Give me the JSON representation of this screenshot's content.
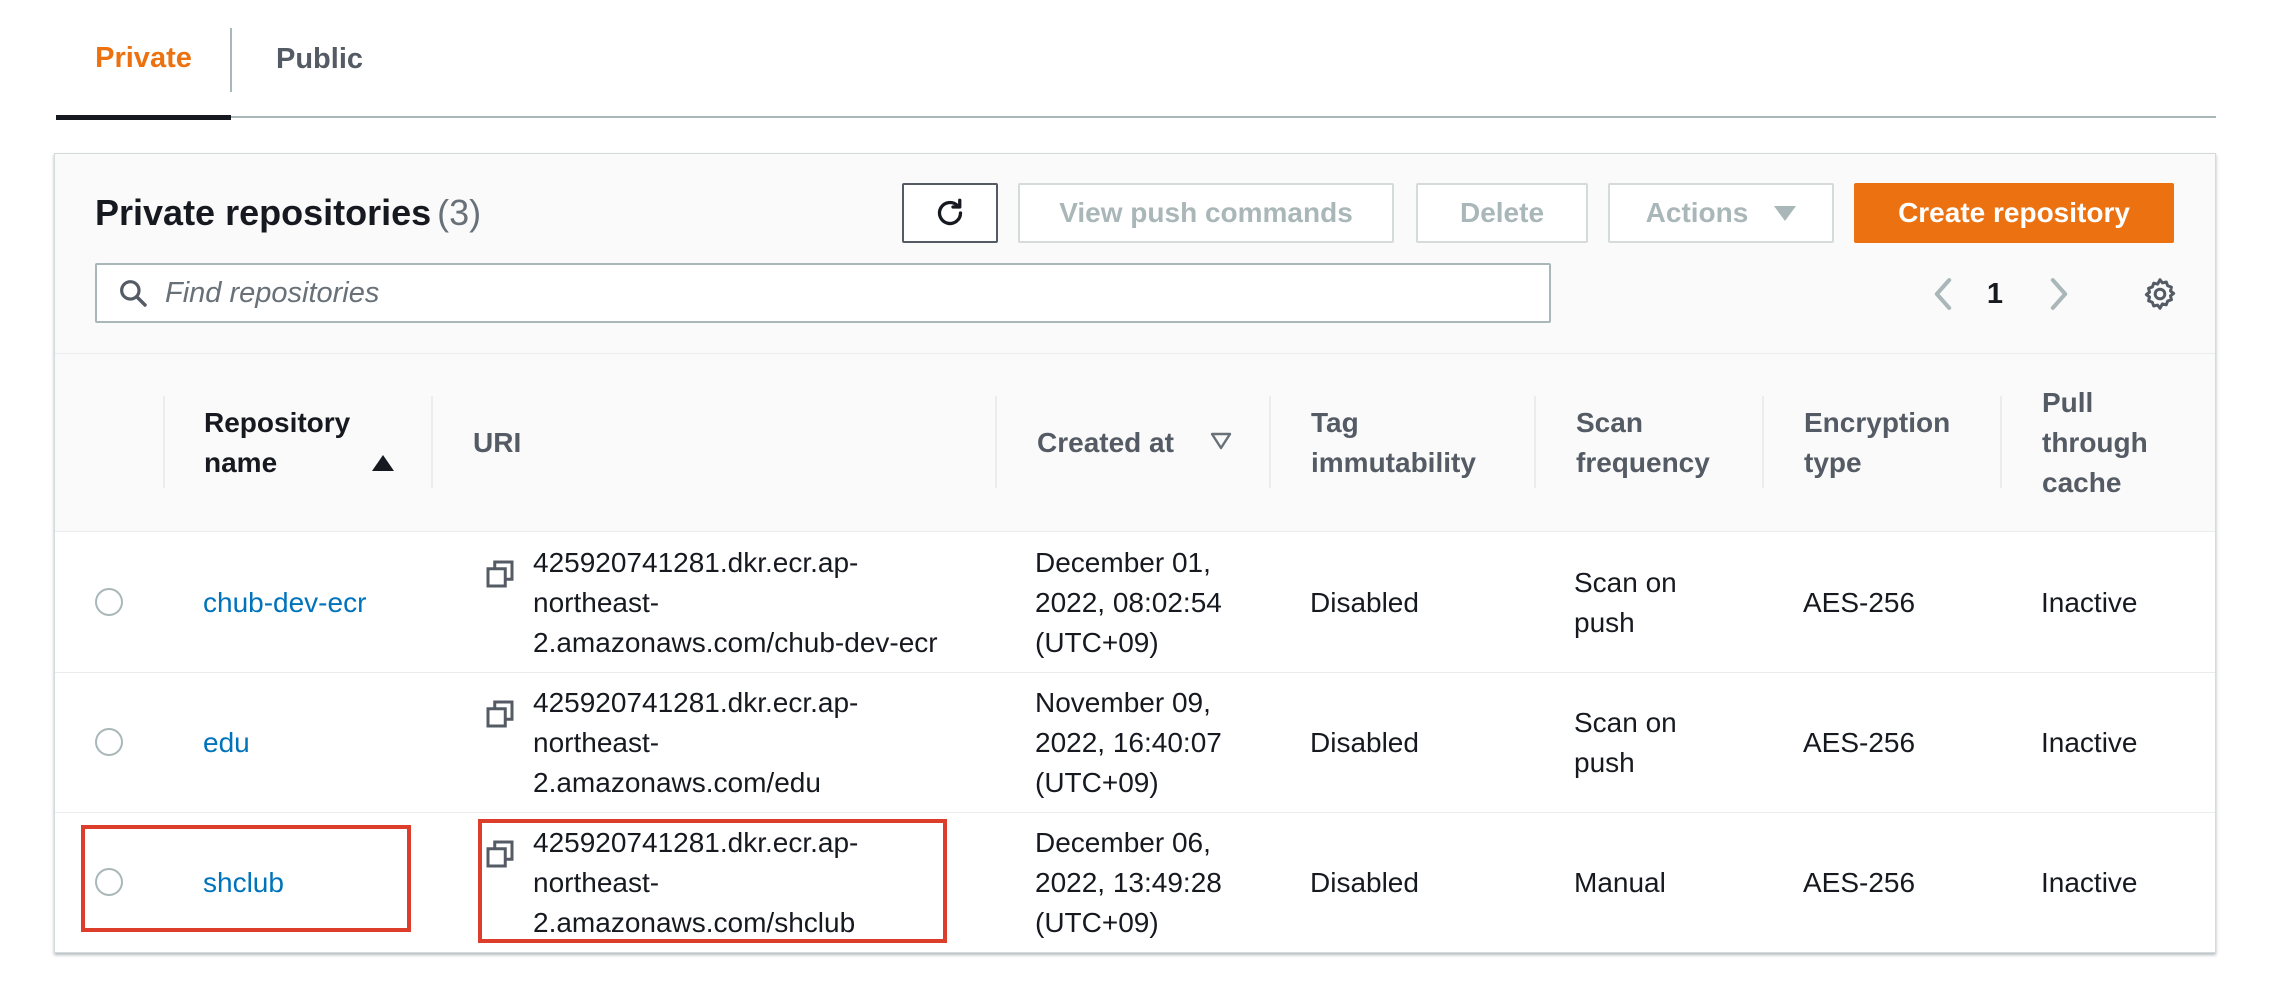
{
  "tabs": [
    {
      "label": "Private",
      "active": true
    },
    {
      "label": "Public",
      "active": false
    }
  ],
  "header": {
    "title": "Private repositories",
    "count": "(3)",
    "buttons": {
      "refresh_icon": "refresh-icon",
      "view_push": "View push commands",
      "delete": "Delete",
      "actions": "Actions",
      "create": "Create repository"
    },
    "search_placeholder": "Find repositories",
    "page": "1"
  },
  "columns": {
    "repo_name_line1": "Repository",
    "repo_name_line2": "name",
    "uri": "URI",
    "created_at": "Created at",
    "tag_line1": "Tag",
    "tag_line2": "immutability",
    "scan_line1": "Scan",
    "scan_line2": "frequency",
    "enc_line1": "Encryption",
    "enc_line2": "type",
    "pull_line1": "Pull",
    "pull_line2": "through",
    "pull_line3": "cache"
  },
  "rows": [
    {
      "name": "chub-dev-ecr",
      "uri_line1": "425920741281.dkr.ecr.ap-",
      "uri_line2": "northeast-",
      "uri_line3": "2.amazonaws.com/chub-dev-ecr",
      "created_line1": "December 01,",
      "created_line2": "2022, 08:02:54",
      "created_line3": "(UTC+09)",
      "tag": "Disabled",
      "scan_line1": "Scan on",
      "scan_line2": "push",
      "encryption": "AES-256",
      "pull": "Inactive"
    },
    {
      "name": "edu",
      "uri_line1": "425920741281.dkr.ecr.ap-",
      "uri_line2": "northeast-",
      "uri_line3": "2.amazonaws.com/edu",
      "created_line1": "November 09,",
      "created_line2": "2022, 16:40:07",
      "created_line3": "(UTC+09)",
      "tag": "Disabled",
      "scan_line1": "Scan on",
      "scan_line2": "push",
      "encryption": "AES-256",
      "pull": "Inactive"
    },
    {
      "name": "shclub",
      "uri_line1": "425920741281.dkr.ecr.ap-",
      "uri_line2": "northeast-",
      "uri_line3": "2.amazonaws.com/shclub",
      "created_line1": "December 06,",
      "created_line2": "2022, 13:49:28",
      "created_line3": "(UTC+09)",
      "tag": "Disabled",
      "scan_line1": "Manual",
      "scan_line2": "",
      "encryption": "AES-256",
      "pull": "Inactive"
    }
  ],
  "colors": {
    "accent": "#ec7211",
    "link": "#0073bb",
    "highlight": "#dd3e2c"
  }
}
